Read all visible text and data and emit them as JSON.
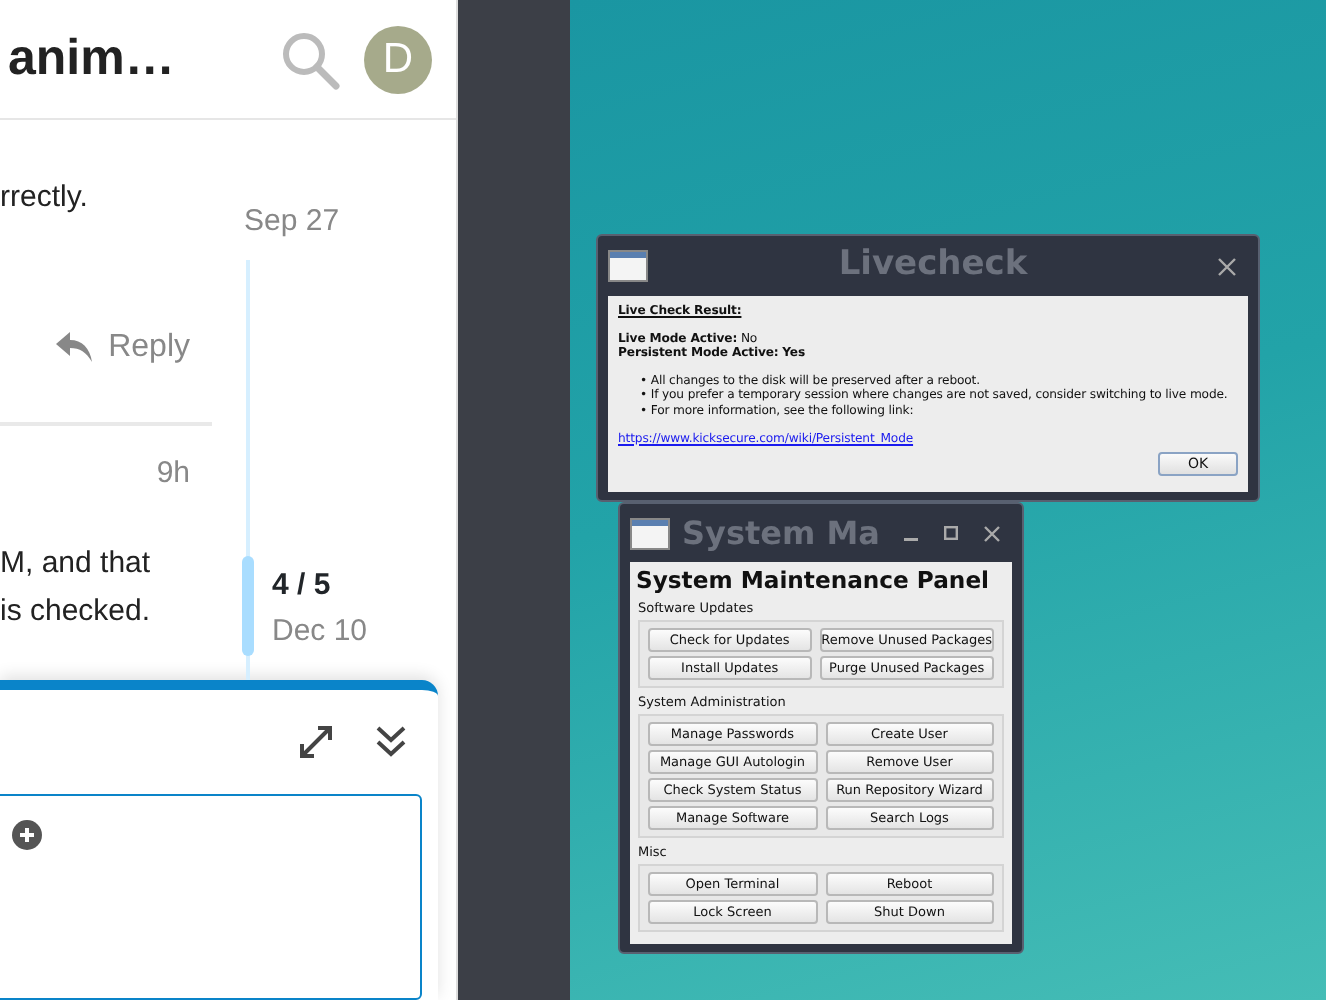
{
  "forum": {
    "topic_title": "anim…",
    "avatar_letter": "D",
    "post_fragment": "rrectly.",
    "reply_label": "Reply",
    "post_time": "9h",
    "post_lines": [
      "M, and that",
      "is checked."
    ],
    "timeline": {
      "start_date": "Sep 27",
      "position": "4 / 5",
      "end_date": "Dec 10"
    }
  },
  "livecheck": {
    "title": "Livecheck",
    "heading": "Live Check Result:",
    "fields": [
      {
        "label": "Live Mode Active:",
        "value": "No",
        "value_bold": false
      },
      {
        "label": "Persistent Mode Active:",
        "value": "Yes",
        "value_bold": true
      }
    ],
    "bullets": [
      "• All changes to the disk will be preserved after a reboot.",
      "• If you prefer a temporary session where changes are not saved, consider switching to live mode.",
      "• For more information, see the following link:"
    ],
    "link": "https://www.kicksecure.com/wiki/Persistent_Mode",
    "ok_label": "OK"
  },
  "maintenance": {
    "title": "System Ma",
    "heading": "System Maintenance Panel",
    "sections": [
      {
        "title": "Software Updates",
        "buttons": [
          "Check for Updates",
          "Remove Unused Packages",
          "Install Updates",
          "Purge Unused Packages"
        ]
      },
      {
        "title": "System Administration",
        "buttons": [
          "Manage Passwords",
          "Create User",
          "Manage GUI Autologin",
          "Remove User",
          "Check System Status",
          "Run Repository Wizard",
          "Manage Software",
          "Search Logs"
        ]
      },
      {
        "title": "Misc",
        "buttons": [
          "Open Terminal",
          "Reboot",
          "Lock Screen",
          "Shut Down"
        ]
      }
    ]
  }
}
